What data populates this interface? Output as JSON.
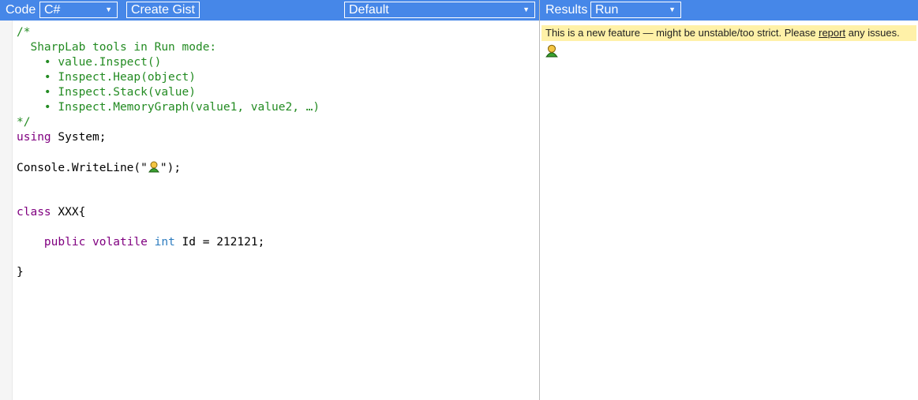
{
  "code_panel": {
    "label": "Code",
    "language_select": "C#",
    "create_gist_label": "Create Gist",
    "branch_select": "Default"
  },
  "results_panel": {
    "label": "Results",
    "mode_select": "Run",
    "banner": {
      "text_before": "This is a new feature — might be unstable/too strict. Please ",
      "link": "report",
      "text_after": " any issues."
    },
    "output_icon": "person-emoji-icon"
  },
  "editor": {
    "lines": {
      "l1": "/*",
      "l2": "  SharpLab tools in Run mode:",
      "l3": "    • value.Inspect()",
      "l4": "    • Inspect.Heap(object)",
      "l5": "    • Inspect.Stack(value)",
      "l6": "    • Inspect.MemoryGraph(value1, value2, …)",
      "l7": "*/",
      "l8_kw": "using",
      "l8_rest": " System;",
      "l10_a": "Console.WriteLine(\"",
      "l10_b": "\");",
      "l13_kw": "class",
      "l13_rest": " XXX{",
      "l15_indent": "    ",
      "l15_kw1": "public",
      "l15_sp1": " ",
      "l15_kw2": "volatile",
      "l15_sp2": " ",
      "l15_ty": "int",
      "l15_rest": " Id = 212121;",
      "l17": "}"
    }
  },
  "colors": {
    "toolbar": "#4687e8",
    "comment": "#238b22",
    "keyword": "#800080",
    "type": "#2b7bbf",
    "banner": "#fff1a8"
  }
}
